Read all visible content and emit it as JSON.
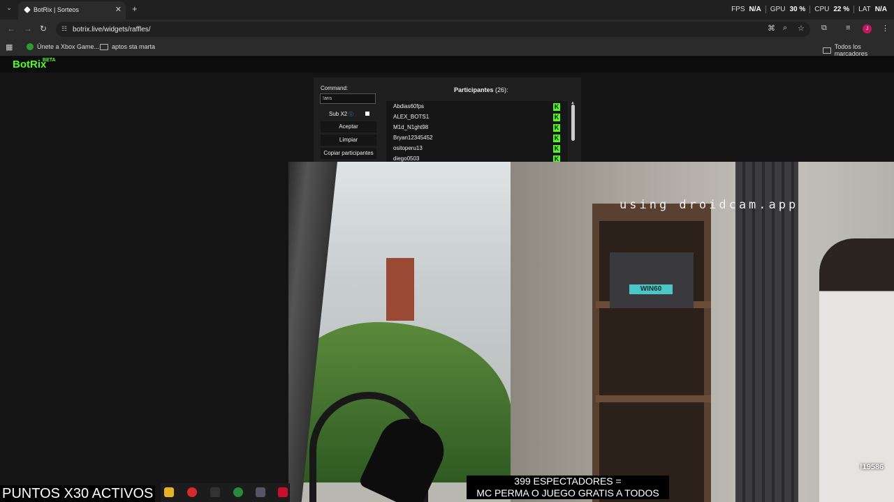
{
  "browser": {
    "tab_title": "BotRix | Sorteos",
    "tab_close": "✕",
    "new_tab": "+",
    "url": "botrix.live/widgets/raffles/",
    "stats": {
      "fps_label": "FPS",
      "fps_value": "N/A",
      "gpu_label": "GPU",
      "gpu_value": "30 %",
      "cpu_label": "CPU",
      "cpu_value": "22 %",
      "lat_label": "LAT",
      "lat_value": "N/A"
    },
    "avatar_letter": "J",
    "bookmarks": [
      "Únete a Xbox Game...",
      "aptos sta marta"
    ],
    "all_bookmarks": "Todos los marcadores"
  },
  "app": {
    "logo": "BotRix",
    "beta": "BETA"
  },
  "raffle": {
    "command_label": "Command:",
    "command_value": "!aris",
    "sub_label": "Sub X2",
    "buttons": [
      "Aceptar",
      "Limpiar",
      "Copiar participantes"
    ],
    "participants_title": "Participantes",
    "participants_count": "(26):",
    "participants": [
      "Abdias60fps",
      "ALEX_BOTS1",
      "M1d_N1ght98",
      "Bryan12345452",
      "ositoperu13",
      "diego0503"
    ]
  },
  "webcam": {
    "watermark": "using droidcam.app",
    "viewers_badge": "!19586"
  },
  "overlays": {
    "puntos": "PUNTOS X30 ACTIVOS",
    "promo_line1": "399 ESPECTADORES =",
    "promo_line2": "MC PERMA O JUEGO GRATIS A TODOS"
  },
  "colors": {
    "accent": "#53fc18",
    "page_bg": "#141414",
    "panel_bg": "#1f1f1f"
  }
}
